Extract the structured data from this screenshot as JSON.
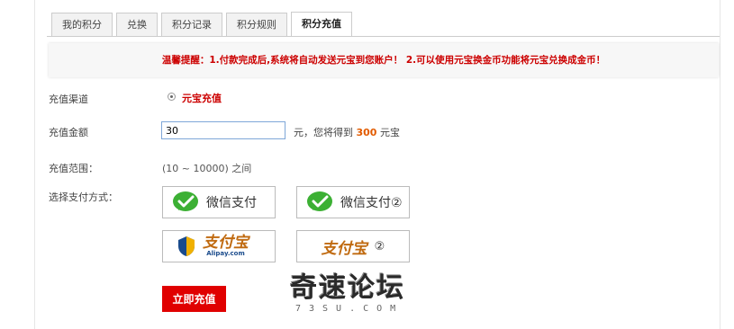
{
  "tabs": [
    "我的积分",
    "兑换",
    "积分记录",
    "积分规则",
    "积分充值"
  ],
  "active_tab": 4,
  "notice": "温馨提醒：1.付款完成后,系统将自动发送元宝到您账户！ 2.可以使用元宝换金币功能将元宝兑换成金币！",
  "form": {
    "channel_label": "充值渠道",
    "channel_option": "元宝充值",
    "amount_label": "充值金额",
    "amount_value": "30",
    "amount_unit": "元，您将得到",
    "amount_result": "300",
    "amount_result_unit": "元宝",
    "range_label": "充值范围：",
    "range_value": "(10 ~ 10000) 之间",
    "pay_label": "选择支付方式："
  },
  "payments": {
    "wechat1": "微信支付",
    "wechat2": "微信支付②",
    "alipay_cn": "支付宝",
    "alipay_en": "Alipay.com",
    "alipay2_cn": "支付宝",
    "alipay2_suffix": "②"
  },
  "submit_label": "立即充值",
  "watermark": {
    "cn": "奇速论坛",
    "en": "73SU.COM"
  },
  "colors": {
    "accent_red": "#e00000",
    "notice_red": "#cc0000",
    "wechat_green": "#3cb034",
    "alipay_orange": "#c06a10"
  }
}
